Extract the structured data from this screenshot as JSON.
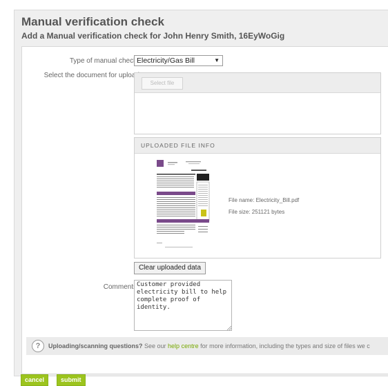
{
  "page": {
    "title": "Manual verification check",
    "subtitle": "Add a Manual verification check for John Henry Smith, 16EyWoGig"
  },
  "form": {
    "type_label": "Type of manual check*",
    "type_value": "Electricity/Gas Bill",
    "doc_label": "Select the document for upload",
    "select_file_label": "Select file",
    "uploaded_info_heading": "UPLOADED FILE INFO",
    "file_name": "File name:  Electricity_Bill.pdf",
    "file_size": "File size:   251121 bytes",
    "clear_button": "Clear uploaded data",
    "comments_label": "Comments*",
    "comments_value": "Customer provided electricity bill to help complete proof of identity."
  },
  "help": {
    "question": "Uploading/scanning questions?",
    "text_before": " See our ",
    "link": "help centre",
    "text_after": " for more information, including the types and size of files we c"
  },
  "actions": {
    "cancel": "cancel",
    "submit": "submit"
  },
  "colors": {
    "accent_green": "#9cc41e",
    "link_green": "#77a800",
    "bill_purple": "#7a4a8a"
  },
  "icons": {
    "help": "question-circle-icon",
    "select_arrow": "triangle-down-icon"
  }
}
